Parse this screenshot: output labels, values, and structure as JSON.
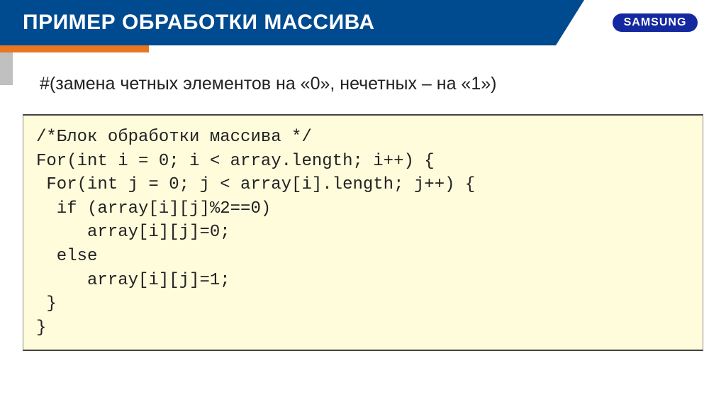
{
  "header": {
    "title": "ПРИМЕР ОБРАБОТКИ МАССИВА",
    "brand": "SAMSUNG"
  },
  "subtitle": "#(замена четных элементов на «0», нечетных – на «1»)",
  "code": {
    "lines": [
      "/*Блок обработки массива */",
      "For(int i = 0; i < array.length; i++) {",
      " For(int j = 0; j < array[i].length; j++) {",
      "  if (array[i][j]%2==0)",
      "     array[i][j]=0;",
      "  else",
      "     array[i][j]=1;",
      " }",
      "}"
    ]
  }
}
